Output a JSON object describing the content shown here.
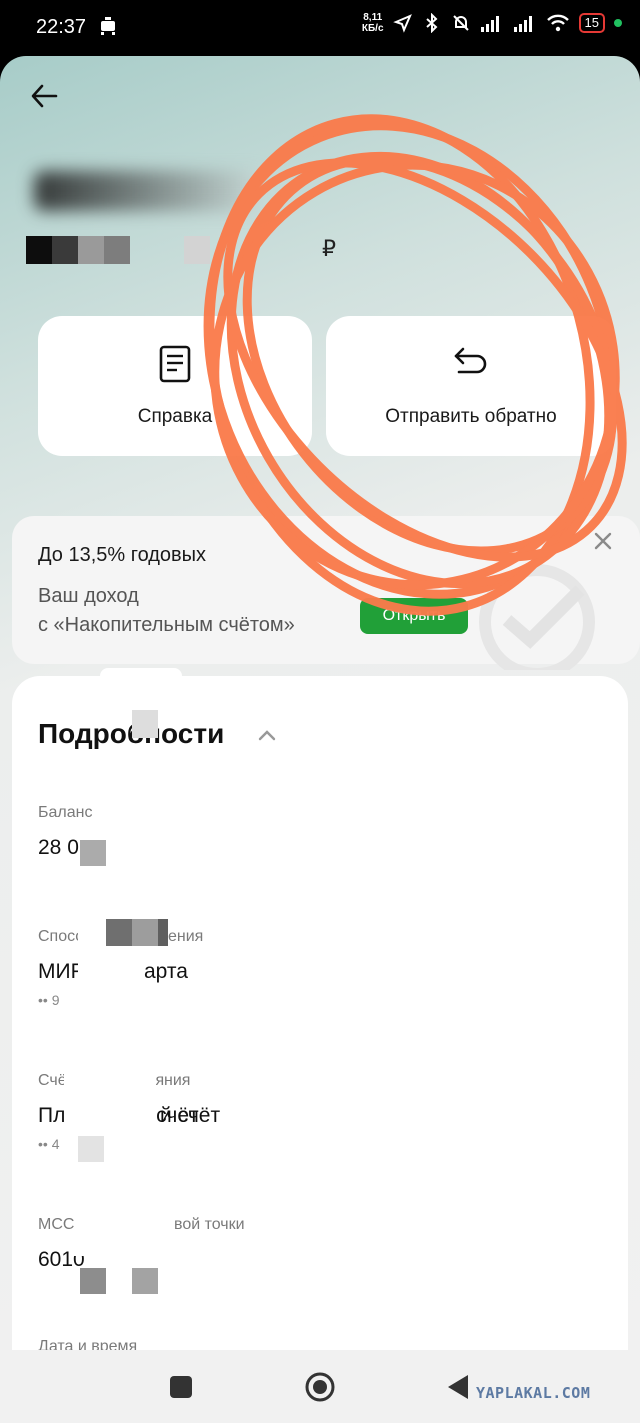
{
  "status_bar": {
    "time": "22:37",
    "net_speed_top": "8,11",
    "net_speed_bottom": "КБ/с",
    "battery": "15"
  },
  "header": {
    "back_icon": "arrow-left-icon",
    "currency": "₽"
  },
  "actions": [
    {
      "label": "Справка",
      "icon": "document-icon"
    },
    {
      "label": "Отправить обратно",
      "icon": "return-arrow-icon"
    }
  ],
  "promo": {
    "title": "До 13,5% годовых",
    "subtitle_line1": "Ваш доход",
    "subtitle_line2": "с «Накопительным счётом»",
    "button": "Открыть",
    "close_icon": "close-icon"
  },
  "details": {
    "title": "Подробности",
    "items": [
      {
        "label": "Баланс",
        "value": "28 0"
      },
      {
        "label": "Способ списания",
        "value": "МИР Карта",
        "extra": "•• 9"
      },
      {
        "label": "Счёт зачисления",
        "value": "Платёжный счёт",
        "extra": "•• 4"
      },
      {
        "label": "MCC торговой точки",
        "value": "6010"
      },
      {
        "label": "Дата и время"
      }
    ]
  },
  "watermark": "YAPLAKAL.COM",
  "colors": {
    "accent_green": "#21a038",
    "scribble": "#fa7b4b",
    "battery_low": "#e53935"
  }
}
